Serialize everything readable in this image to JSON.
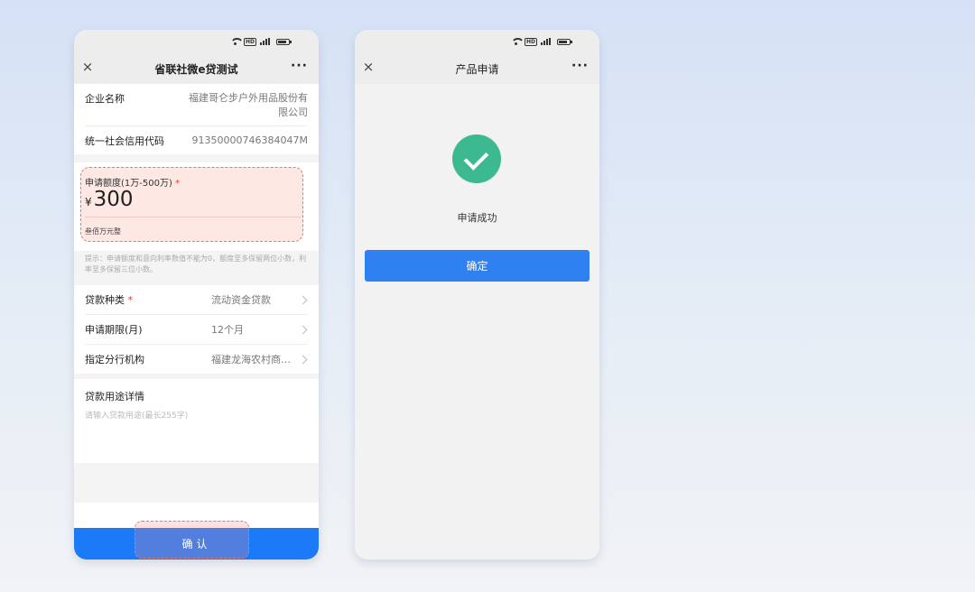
{
  "left_phone": {
    "title": "省联社微e贷测试",
    "close_icon": "×",
    "more_icon": "···",
    "company": {
      "label": "企业名称",
      "value": "福建哥仑步户外用品股份有限公司"
    },
    "credit_code": {
      "label": "统一社会信用代码",
      "value": "91350000746384047M"
    },
    "amount": {
      "label": "申请额度(1万-500万)",
      "required": "*",
      "currency": "¥",
      "value": "300",
      "words": "叁佰万元整"
    },
    "tip": "提示：申请额度和意向利率数值不能为0，额度至多保留两位小数，利率至多保留三位小数。",
    "loan_type": {
      "label": "贷款种类",
      "required": "*",
      "value": "流动资金贷款"
    },
    "term": {
      "label": "申请期限(月)",
      "value": "12个月"
    },
    "branch": {
      "label": "指定分行机构",
      "value": "福建龙海农村商业银行"
    },
    "purpose": {
      "label": "贷款用途详情",
      "placeholder": "请输入贷款用途(最长255字)"
    },
    "confirm_label": "确认"
  },
  "right_phone": {
    "title": "产品申请",
    "close_icon": "×",
    "more_icon": "···",
    "status_icon": "check-circle-icon",
    "status_text": "申请成功",
    "ok_label": "确定"
  },
  "colors": {
    "primary_blue": "#1a7af8",
    "success_green": "#3cb991",
    "highlight_red": "#e07a74"
  }
}
